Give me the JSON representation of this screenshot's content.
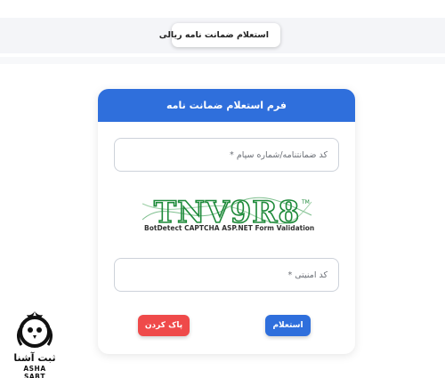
{
  "top_tab": {
    "label": "استعلام ضمانت نامه ریالی",
    "icon": "shield-check-icon"
  },
  "form": {
    "title": "فرم استعلام ضمانت نامه",
    "code_placeholder": "کد ضمانتنامه/شماره سپام *",
    "captcha_text": "TNV9R8",
    "captcha_caption": "BotDetect CAPTCHA ASP.NET Form Validation",
    "security_placeholder": "کد امنیتی *",
    "submit_label": "استعلام",
    "clear_label": "پاک کردن"
  },
  "logo": {
    "fa": "ثبت آشنا",
    "en": "ASHA SABT"
  },
  "colors": {
    "primary": "#2f6fdc",
    "danger": "#ef4a4a",
    "captcha": "#1e8a3a"
  }
}
